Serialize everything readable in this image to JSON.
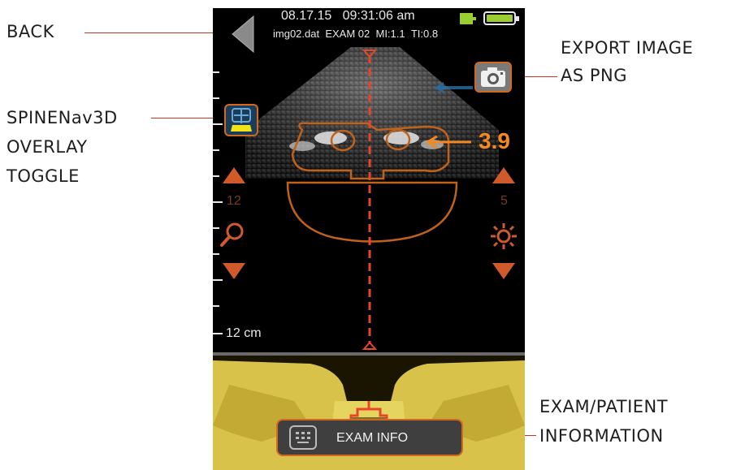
{
  "status": {
    "date": "08.17.15",
    "time": "09:31:06 am",
    "file": "img02.dat",
    "exam": "EXAM 02",
    "mi": "MI:1.1",
    "ti": "TI:0.8"
  },
  "depth": {
    "value": "12",
    "unit_label": "12 cm"
  },
  "gain": {
    "value": "5"
  },
  "measurement": {
    "distance": "3.9"
  },
  "exam_info_button": {
    "label": "EXAM INFO"
  },
  "annotations": {
    "back": "BACK",
    "export_line1": "EXPORT IMAGE",
    "export_line2": "AS PNG",
    "overlay_line1": "SPINENav3D",
    "overlay_line2": "OVERLAY",
    "overlay_line3": "TOGGLE",
    "exam_line1": "EXAM/PATIENT",
    "exam_line2": "INFORMATION"
  },
  "colors": {
    "accent": "#d05a2a",
    "measurement": "#f5891f",
    "callout_line": "#c0392b",
    "battery": "#9acd32"
  },
  "icons": [
    "back-arrow-icon",
    "camera-icon",
    "spine-overlay-icon",
    "magnifier-icon",
    "brightness-icon",
    "keyboard-icon",
    "battery-icon",
    "probe-icon"
  ]
}
